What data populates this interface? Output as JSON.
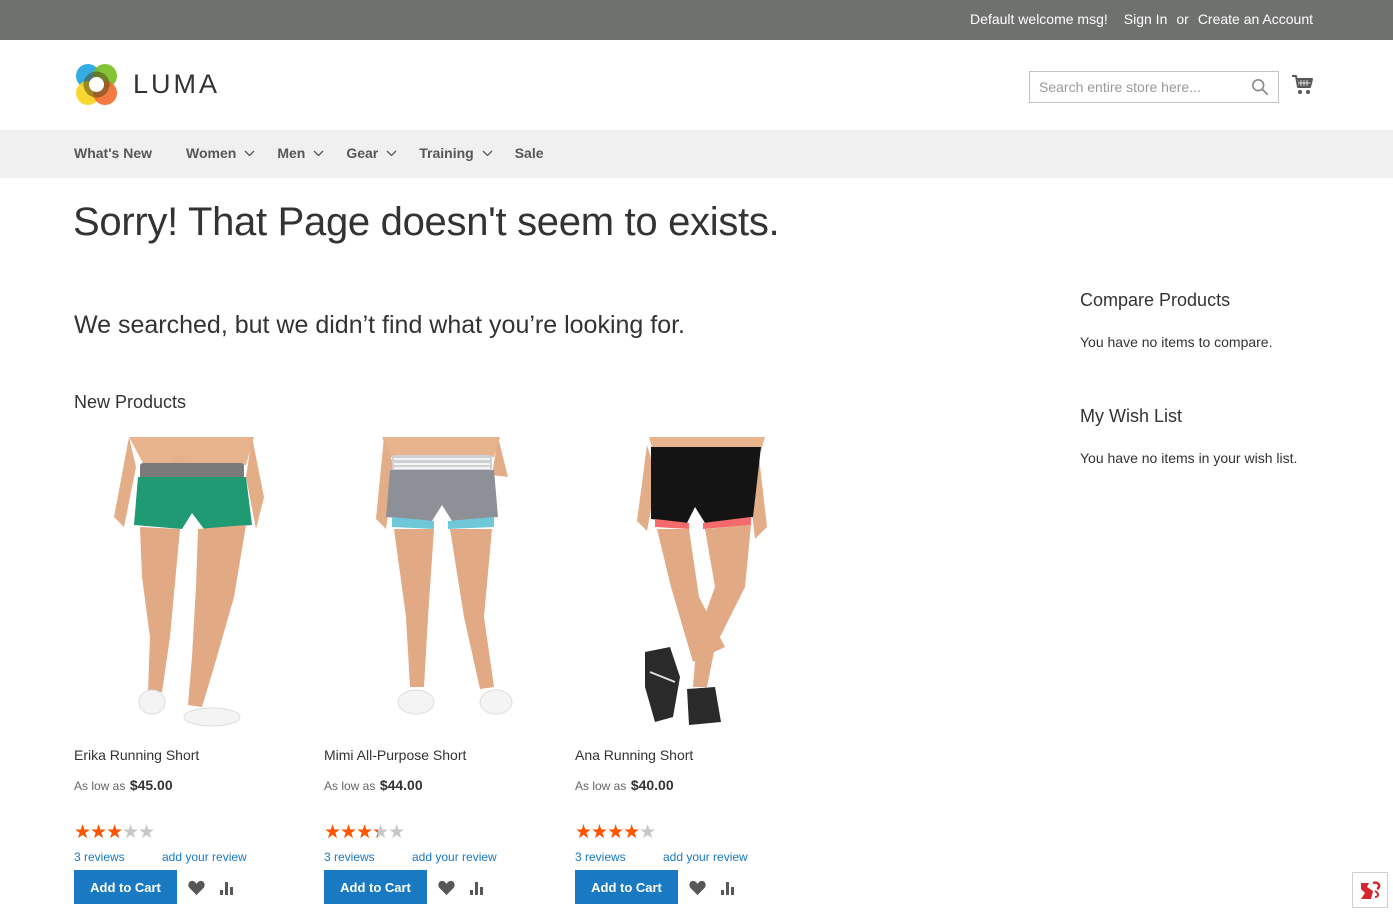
{
  "topbar": {
    "welcome": "Default welcome msg!",
    "sign_in": "Sign In",
    "or": "or",
    "create_account": "Create an Account"
  },
  "header": {
    "logo_text": "LUMA",
    "search_placeholder": "Search entire store here...",
    "search_value": ""
  },
  "nav": {
    "items": [
      {
        "label": "What's New",
        "has_submenu": false
      },
      {
        "label": "Women",
        "has_submenu": true
      },
      {
        "label": "Men",
        "has_submenu": true
      },
      {
        "label": "Gear",
        "has_submenu": true
      },
      {
        "label": "Training",
        "has_submenu": true
      },
      {
        "label": "Sale",
        "has_submenu": false
      }
    ]
  },
  "main": {
    "page_title": "Sorry! That Page doesn't seem to exists.",
    "subtitle": "We searched, but we didn’t find what you’re looking for.",
    "section_title": "New Products",
    "products": [
      {
        "name": "Erika Running Short",
        "price_label": "As low as",
        "price": "$45.00",
        "rating_percent": 60,
        "reviews": "3  reviews",
        "add_review": "add your review",
        "button": "Add to Cart",
        "colors": {
          "short": "#1f9a72",
          "band": "#7a7a7a",
          "liner": "#1f9a72"
        }
      },
      {
        "name": "Mimi All-Purpose Short",
        "price_label": "As low as",
        "price": "$44.00",
        "rating_percent": 67,
        "reviews": "3  reviews",
        "add_review": "add your review",
        "button": "Add to Cart",
        "colors": {
          "short": "#8e9097",
          "band": "#cfd0d4",
          "liner": "#6fc8d8"
        }
      },
      {
        "name": "Ana Running Short",
        "price_label": "As low as",
        "price": "$40.00",
        "rating_percent": 80,
        "reviews": "3  reviews",
        "add_review": "add your review",
        "button": "Add to Cart",
        "colors": {
          "short": "#141414",
          "band": "#1a1a1a",
          "liner": "#f56a6a"
        }
      }
    ]
  },
  "sidebar": {
    "compare_title": "Compare Products",
    "compare_empty": "You have no items to compare.",
    "wishlist_title": "My Wish List",
    "wishlist_empty": "You have no items in your wish list."
  },
  "colors": {
    "topbar_bg": "#6e716e",
    "nav_bg": "#f0f0f0",
    "button_primary": "#1979c3",
    "link": "#1979c3",
    "star_active": "#ff5501",
    "star_inactive": "#c7c7c7"
  }
}
